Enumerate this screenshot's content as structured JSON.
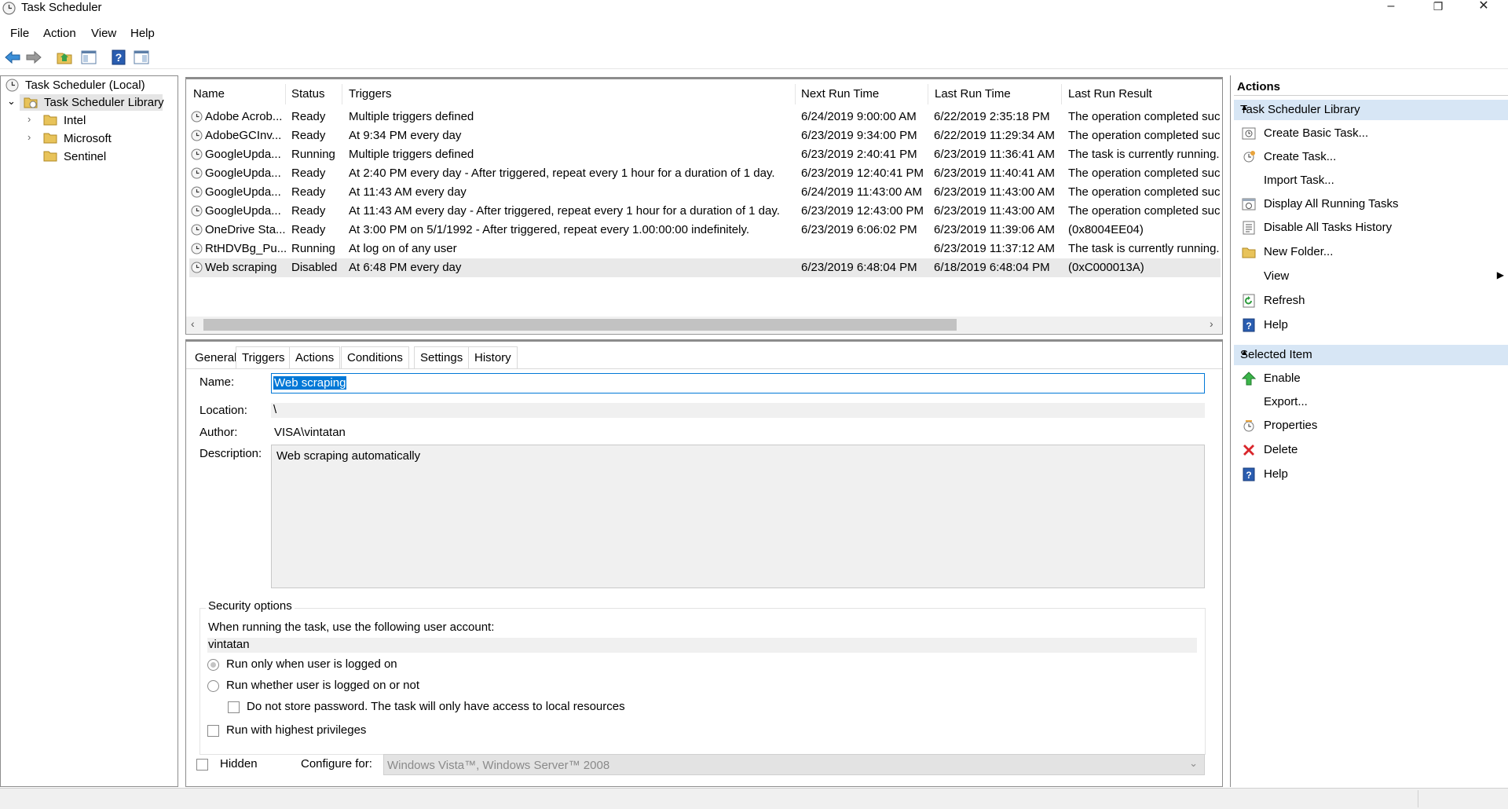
{
  "window": {
    "title": "Task Scheduler",
    "minimize": "–",
    "restore": "❐",
    "close": "✕"
  },
  "menu": [
    "File",
    "Action",
    "View",
    "Help"
  ],
  "tree": {
    "root": "Task Scheduler (Local)",
    "library": "Task Scheduler Library",
    "folders": [
      "Intel",
      "Microsoft",
      "Sentinel"
    ]
  },
  "table": {
    "columns": [
      "Name",
      "Status",
      "Triggers",
      "Next Run Time",
      "Last Run Time",
      "Last Run Result"
    ],
    "rows": [
      [
        "Adobe Acrob...",
        "Ready",
        "Multiple triggers defined",
        "6/24/2019 9:00:00 AM",
        "6/22/2019 2:35:18 PM",
        "The operation completed succ"
      ],
      [
        "AdobeGCInv...",
        "Ready",
        "At 9:34 PM every day",
        "6/23/2019 9:34:00 PM",
        "6/22/2019 11:29:34 AM",
        "The operation completed succ"
      ],
      [
        "GoogleUpda...",
        "Running",
        "Multiple triggers defined",
        "6/23/2019 2:40:41 PM",
        "6/23/2019 11:36:41 AM",
        "The task is currently running. ("
      ],
      [
        "GoogleUpda...",
        "Ready",
        "At 2:40 PM every day - After triggered, repeat every 1 hour for a duration of 1 day.",
        "6/23/2019 12:40:41 PM",
        "6/23/2019 11:40:41 AM",
        "The operation completed succ"
      ],
      [
        "GoogleUpda...",
        "Ready",
        "At 11:43 AM every day",
        "6/24/2019 11:43:00 AM",
        "6/23/2019 11:43:00 AM",
        "The operation completed succ"
      ],
      [
        "GoogleUpda...",
        "Ready",
        "At 11:43 AM every day - After triggered, repeat every 1 hour for a duration of 1 day.",
        "6/23/2019 12:43:00 PM",
        "6/23/2019 11:43:00 AM",
        "The operation completed succ"
      ],
      [
        "OneDrive Sta...",
        "Ready",
        "At 3:00 PM on 5/1/1992 - After triggered, repeat every 1.00:00:00 indefinitely.",
        "6/23/2019 6:06:02 PM",
        "6/23/2019 11:39:06 AM",
        "(0x8004EE04)"
      ],
      [
        "RtHDVBg_Pu...",
        "Running",
        "At log on of any user",
        "",
        "6/23/2019 11:37:12 AM",
        "The task is currently running. ("
      ],
      [
        "Web scraping",
        "Disabled",
        "At 6:48 PM every day",
        "6/23/2019 6:48:04 PM",
        "6/18/2019 6:48:04 PM",
        "(0xC000013A)"
      ]
    ],
    "selected_index": 8
  },
  "tabs": [
    "General",
    "Triggers",
    "Actions",
    "Conditions",
    "Settings",
    "History"
  ],
  "general": {
    "name_label": "Name:",
    "name_value": "Web scraping",
    "location_label": "Location:",
    "location_value": "\\",
    "author_label": "Author:",
    "author_value": "VISA\\vintatan",
    "description_label": "Description:",
    "description_value": "Web scraping automatically",
    "security_title": "Security options",
    "account_prompt": "When running the task, use the following user account:",
    "account_value": "vintatan",
    "radio_logged_on": "Run only when user is logged on",
    "radio_whether": "Run whether user is logged on or not",
    "no_store_pw": "Do not store password.  The task will only have access to local resources",
    "highest_priv": "Run with highest privileges",
    "hidden_label": "Hidden",
    "configure_label": "Configure for:",
    "configure_value": "Windows Vista™, Windows Server™ 2008"
  },
  "actions_pane": {
    "title": "Actions",
    "section1": "Task Scheduler Library",
    "section1_items": [
      "Create Basic Task...",
      "Create Task...",
      "Import Task...",
      "Display All Running Tasks",
      "Disable All Tasks History",
      "New Folder...",
      "View",
      "Refresh",
      "Help"
    ],
    "section2": "Selected Item",
    "section2_items": [
      "Enable",
      "Export...",
      "Properties",
      "Delete",
      "Help"
    ]
  },
  "icons": [
    "clock-icon",
    "folder-icon",
    "back-arrow-icon",
    "forward-arrow-icon",
    "help-icon",
    "delete-icon",
    "enable-arrow-icon"
  ],
  "colors": {
    "selection": "#e9e9e9",
    "section_header": "#d7e6f5",
    "name_highlight": "#0078d7"
  }
}
